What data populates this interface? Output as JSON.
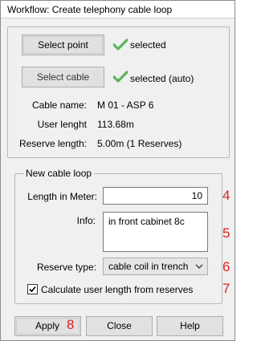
{
  "window": {
    "title": "Workflow: Create telephony cable loop"
  },
  "top_panel": {
    "select_point_label": "Select point",
    "select_point_status": "selected",
    "select_cable_label": "Select cable",
    "select_cable_status": "selected (auto)",
    "cable_name_label": "Cable name:",
    "cable_name_value": "M 01 - ASP 6",
    "user_length_label": "User lenght",
    "user_length_value": "113.68m",
    "reserve_length_label": "Reserve length:",
    "reserve_length_value": "5.00m (1 Reserves)"
  },
  "new_loop": {
    "legend": "New cable loop",
    "length_label": "Length in Meter:",
    "length_value": "10",
    "length_marker": "4",
    "info_label": "Info:",
    "info_value": "in front cabinet 8c",
    "info_marker": "5",
    "reserve_type_label": "Reserve type:",
    "reserve_type_value": "cable coil in trench",
    "reserve_type_marker": "6",
    "calc_checkbox_label": "Calculate user length from reserves",
    "calc_checkbox_checked": true,
    "calc_marker": "7"
  },
  "footer": {
    "apply_label": "Apply",
    "apply_marker": "8",
    "close_label": "Close",
    "help_label": "Help"
  },
  "colors": {
    "marker": "#e02020",
    "check": "#2e9e2e"
  }
}
